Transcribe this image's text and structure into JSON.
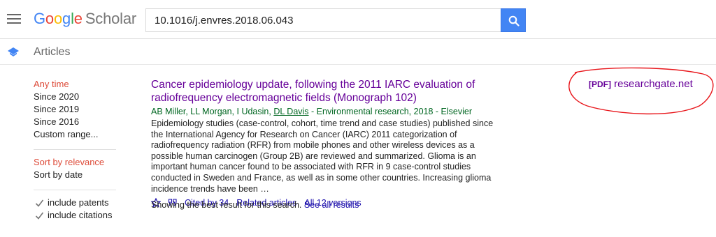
{
  "header": {
    "logo_google": [
      "G",
      "o",
      "o",
      "g",
      "l",
      "e"
    ],
    "logo_scholar": "Scholar",
    "search_value": "10.1016/j.envres.2018.06.043"
  },
  "subheader": {
    "label": "Articles"
  },
  "sidebar": {
    "time_filters": [
      "Any time",
      "Since 2020",
      "Since 2019",
      "Since 2016",
      "Custom range..."
    ],
    "sort_options": [
      "Sort by relevance",
      "Sort by date"
    ],
    "checkboxes": [
      {
        "label": "include patents",
        "checked": true
      },
      {
        "label": "include citations",
        "checked": true
      }
    ]
  },
  "result": {
    "title": "Cancer epidemiology update, following the 2011 IARC evaluation of radiofrequency electromagnetic fields (Monograph 102)",
    "authors_pre": "AB Miller, LL Morgan, I Udasin, ",
    "author_link": "DL Davis",
    "authors_post": " - Environmental research, 2018 - Elsevier",
    "snippet": "Epidemiology studies (case-control, cohort, time trend and case studies) published since the International Agency for Research on Cancer (IARC) 2011 categorization of radiofrequency radiation (RFR) from mobile phones and other wireless devices as a possible human carcinogen (Group 2B) are reviewed and summarized. Glioma is an important human cancer found to be associated with RFR in 9 case-control studies conducted in Sweden and France, as well as in some other countries. Increasing glioma incidence trends have been …",
    "cited_by": "Cited by 34",
    "related": "Related articles",
    "versions": "All 12 versions"
  },
  "pdf": {
    "tag": "[PDF]",
    "source": "researchgate.net"
  },
  "showing": {
    "text": "Showing the best result for this search. ",
    "link": "See all results"
  },
  "colors": {
    "accent": "#4285f4",
    "active_filter": "#dd4b39",
    "visited_link": "#660099",
    "link": "#1a0dab",
    "source_green": "#006621",
    "annotation_red": "#e8161b"
  },
  "icons": [
    "menu-icon",
    "search-icon",
    "articles-icon",
    "checkmark-icon",
    "star-icon",
    "quote-icon"
  ]
}
